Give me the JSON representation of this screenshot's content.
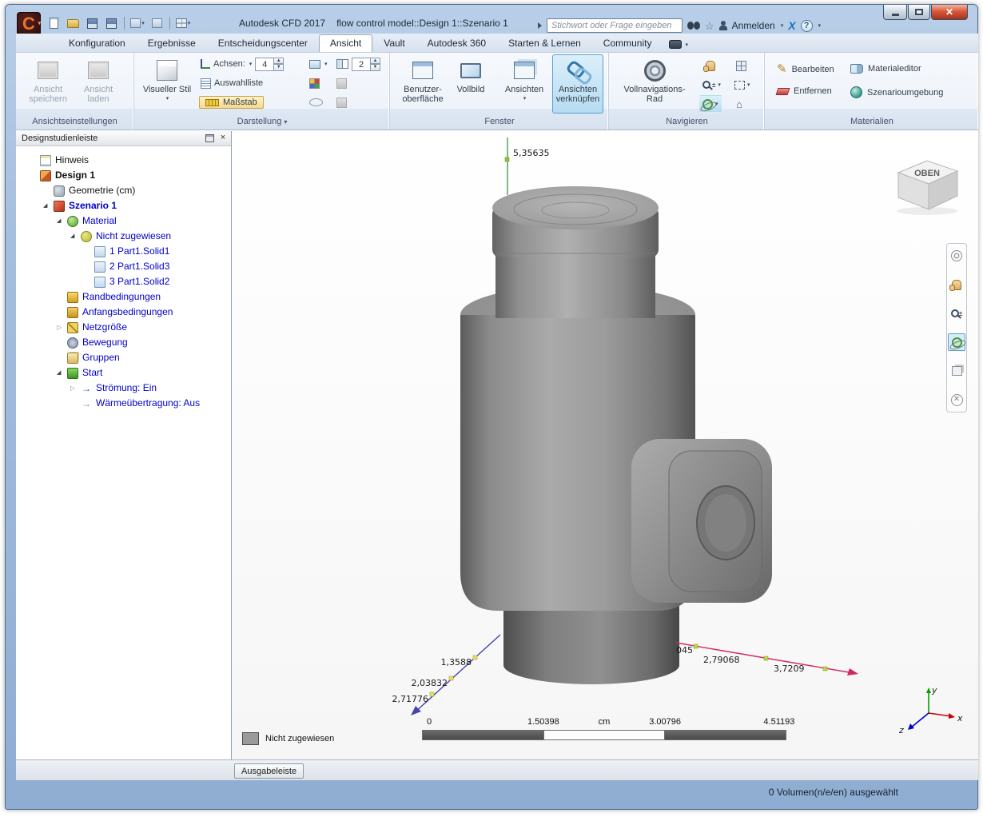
{
  "titlebar": {
    "app_title": "Autodesk CFD 2017",
    "doc_title": "flow control model::Design 1::Szenario 1",
    "search_placeholder": "Stichwort oder Frage eingeben",
    "signin_label": "Anmelden"
  },
  "menu_tabs": [
    {
      "id": "konfiguration",
      "label": "Konfiguration",
      "active": false
    },
    {
      "id": "ergebnisse",
      "label": "Ergebnisse",
      "active": false
    },
    {
      "id": "entscheidungscenter",
      "label": "Entscheidungscenter",
      "active": false
    },
    {
      "id": "ansicht",
      "label": "Ansicht",
      "active": true
    },
    {
      "id": "vault",
      "label": "Vault",
      "active": false
    },
    {
      "id": "autodesk-360",
      "label": "Autodesk 360",
      "active": false
    },
    {
      "id": "starten-lernen",
      "label": "Starten & Lernen",
      "active": false
    },
    {
      "id": "community",
      "label": "Community",
      "active": false
    }
  ],
  "ribbon": {
    "view_settings": {
      "group_label": "Ansichtseinstellungen",
      "save_view_lines": [
        "Ansicht",
        "speichern"
      ],
      "load_view_lines": [
        "Ansicht",
        "laden"
      ]
    },
    "display": {
      "group_label": "Darstellung",
      "visual_style_label": "Visueller Stil",
      "axes_label": "Achsen:",
      "axes_value": "4",
      "selection_list_label": "Auswahlliste",
      "scale_label": "Maßstab",
      "layout_value": "2"
    },
    "window_group": {
      "group_label": "Fenster",
      "ui_lines": [
        "Benutzer-",
        "oberfläche"
      ],
      "fullscreen_label": "Vollbild",
      "views_label": "Ansichten",
      "link_views_lines": [
        "Ansichten",
        "verknüpfen"
      ]
    },
    "navigate": {
      "group_label": "Navigieren",
      "wheel_lines": [
        "Vollnavigations-",
        "Rad"
      ]
    },
    "materials": {
      "group_label": "Materialien",
      "edit_label": "Bearbeiten",
      "remove_label": "Entfernen",
      "editor_label": "Materialeditor",
      "environment_label": "Szenarioumgebung"
    }
  },
  "design_bar": {
    "title": "Designstudienleiste",
    "items": [
      {
        "id": "hinweis",
        "label": "Hinweis",
        "depth": 1,
        "icon": "note",
        "style": "black"
      },
      {
        "id": "design-1",
        "label": "Design 1",
        "depth": 1,
        "icon": "design",
        "style": "bold-black"
      },
      {
        "id": "geometrie",
        "label": "Geometrie (cm)",
        "depth": 2,
        "icon": "geometry",
        "style": "black"
      },
      {
        "id": "szenario-1",
        "label": "Szenario 1",
        "depth": 2,
        "icon": "scenario",
        "style": "bold-blue",
        "expand": "open"
      },
      {
        "id": "material",
        "label": "Material",
        "depth": 3,
        "icon": "material",
        "style": "blue",
        "expand": "open"
      },
      {
        "id": "nicht-zugewiesen",
        "label": "Nicht zugewiesen",
        "depth": 4,
        "icon": "material2",
        "style": "blue",
        "expand": "open"
      },
      {
        "id": "part1-solid1",
        "label": "1 Part1.Solid1",
        "depth": 5,
        "icon": "solid",
        "style": "blue"
      },
      {
        "id": "part1-solid3",
        "label": "2 Part1.Solid3",
        "depth": 5,
        "icon": "solid",
        "style": "blue"
      },
      {
        "id": "part1-solid2",
        "label": "3 Part1.Solid2",
        "depth": 5,
        "icon": "solid",
        "style": "blue"
      },
      {
        "id": "randbedingungen",
        "label": "Randbedingungen",
        "depth": 3,
        "icon": "boundary",
        "style": "blue"
      },
      {
        "id": "anfangsbedingungen",
        "label": "Anfangsbedingungen",
        "depth": 3,
        "icon": "initial",
        "style": "blue"
      },
      {
        "id": "netzgroesse",
        "label": "Netzgröße",
        "depth": 3,
        "icon": "mesh",
        "style": "blue",
        "expand": "closed"
      },
      {
        "id": "bewegung",
        "label": "Bewegung",
        "depth": 3,
        "icon": "motion",
        "style": "blue"
      },
      {
        "id": "gruppen",
        "label": "Gruppen",
        "depth": 3,
        "icon": "groups",
        "style": "blue"
      },
      {
        "id": "start",
        "label": "Start",
        "depth": 3,
        "icon": "start",
        "style": "blue",
        "expand": "open"
      },
      {
        "id": "stroemung",
        "label": "Strömung: Ein",
        "depth": 4,
        "icon": "flow",
        "style": "blue",
        "expand": "closed"
      },
      {
        "id": "waermeuebertragung",
        "label": "Wärmeübertragung: Aus",
        "depth": 4,
        "icon": "heat",
        "style": "blue"
      }
    ]
  },
  "viewport": {
    "viewcube_label": "OBEN",
    "y_axis_label": "5,35635",
    "x_axis_labels": [
      "045",
      "2,79068",
      "3,7209"
    ],
    "z_axis_labels": [
      "1,3588",
      "2,03832",
      "2,71776"
    ],
    "triad_labels": {
      "x": "x",
      "y": "y",
      "z": "z"
    },
    "scale": {
      "ticks": [
        "0",
        "1.50398",
        "3.00796",
        "4.51193"
      ],
      "unit": "cm"
    },
    "legend_label": "Nicht zugewiesen"
  },
  "bottom": {
    "output_bar_label": "Ausgabeleiste",
    "status_text": "0 Volumen(n/e/en) ausgewählt"
  }
}
